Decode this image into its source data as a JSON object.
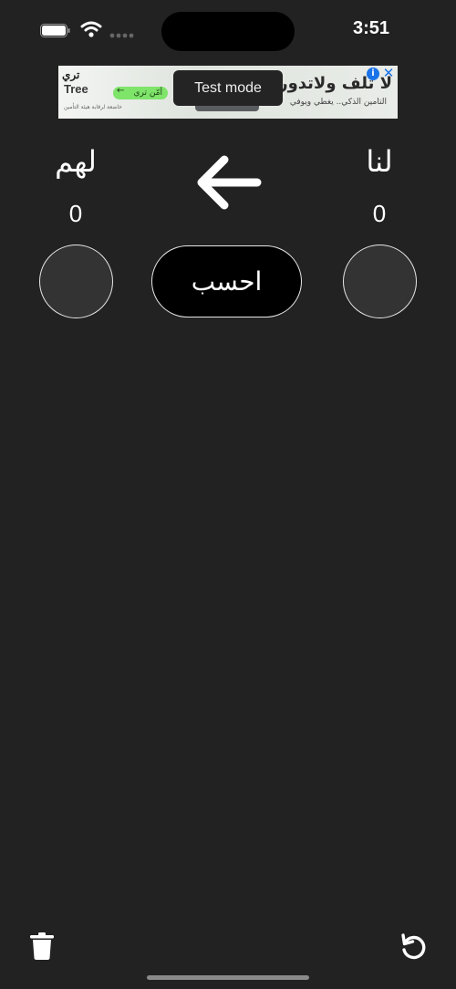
{
  "status_bar": {
    "time": "3:51"
  },
  "ad": {
    "logo_arabic": "تري",
    "logo_latin": "Tree",
    "cta": "أمّن تري",
    "headline": "لا تلف ولاتدور",
    "subline": "التأمين الذكي.. يغطي ويوفي",
    "small_print": "خاضعة لرقابة هيئة التأمين",
    "info_symbol": "i",
    "close_symbol": "✕",
    "overlay": "Test mode"
  },
  "scoreboard": {
    "them_label": "لهم",
    "us_label": "لنا",
    "them_score": "0",
    "us_score": "0",
    "calculate_label": "احسب",
    "arrow_icon": "arrow-left-icon"
  },
  "bottom_bar": {
    "delete_icon": "trash-icon",
    "undo_icon": "undo-icon"
  },
  "colors": {
    "background": "#222222",
    "circle_fill": "#333333",
    "button_fill": "#000000",
    "border": "#e6e6e6"
  }
}
